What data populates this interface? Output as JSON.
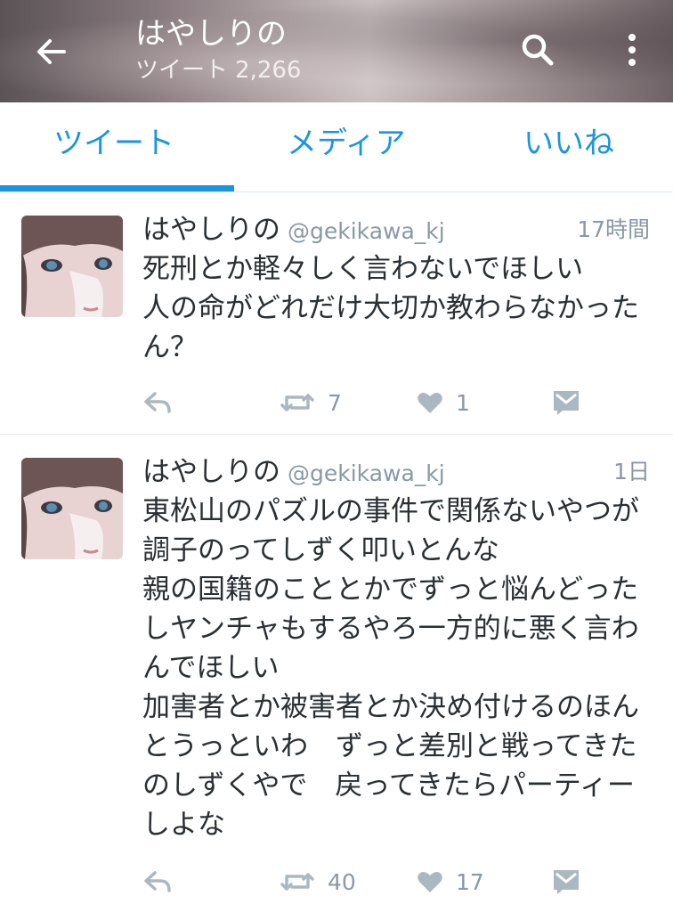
{
  "header": {
    "title": "はやしりの",
    "tweets_label": "ツイート",
    "tweets_count": "2,266"
  },
  "tabs": [
    {
      "label": "ツイート",
      "active": true
    },
    {
      "label": "メディア",
      "active": false
    },
    {
      "label": "いいね",
      "active": false
    }
  ],
  "colors": {
    "accent": "#1b95e0",
    "icon_gray": "#aab8c2",
    "text": "#292f33",
    "meta": "#8899a6"
  },
  "icons": [
    "arrow-left-icon",
    "search-icon",
    "more-vertical-icon",
    "reply-icon",
    "retweet-icon",
    "heart-icon",
    "direct-message-icon"
  ],
  "tweets": [
    {
      "name": "はやしりの",
      "handle": "@gekikawa_kj",
      "time": "17時間",
      "text": "死刑とか軽々しく言わないでほしい\n人の命がどれだけ大切か教わらなかったん？",
      "retweets": "7",
      "likes": "1"
    },
    {
      "name": "はやしりの",
      "handle": "@gekikawa_kj",
      "time": "1日",
      "text": "東松山のパズルの事件で関係ないやつが調子のってしずく叩いとんな\n親の国籍のこととかでずっと悩んどったしヤンチャもするやろ一方的に悪く言わんでほしい\n加害者とか被害者とか決め付けるのほんとうっといわ　ずっと差別と戦ってきたのしずくやで　戻ってきたらパーティーしよな",
      "retweets": "40",
      "likes": "17"
    }
  ]
}
